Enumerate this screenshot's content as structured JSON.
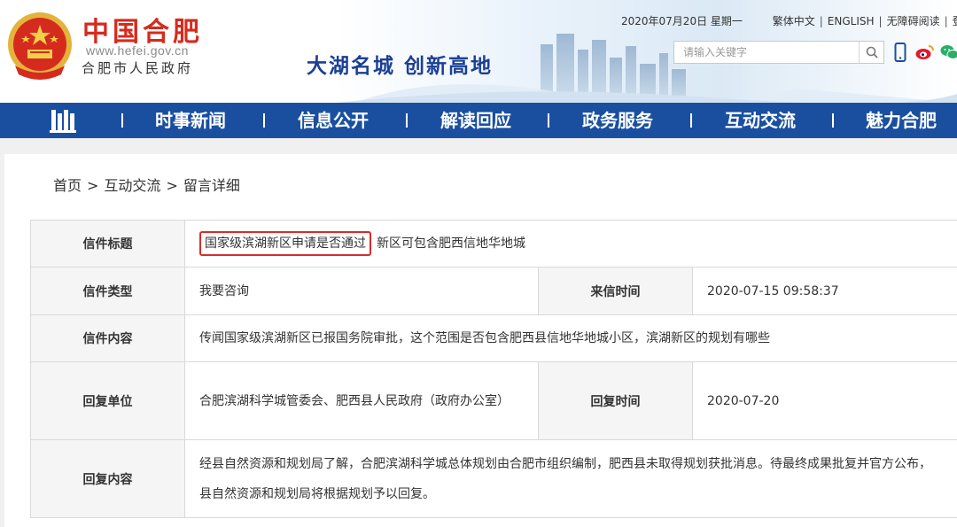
{
  "header": {
    "site_name": "中国合肥",
    "site_url": "www.hefei.gov.cn",
    "org_name": "合肥市人民政府",
    "slogan": "大湖名城  创新高地",
    "date": "2020年07月20日 星期一",
    "links": [
      "繁体中文",
      "ENGLISH",
      "无障碍阅读",
      "登"
    ],
    "search_placeholder": "请输入关键字",
    "icons": [
      "search-icon",
      "mobile-icon",
      "weibo-icon",
      "wechat-icon"
    ]
  },
  "nav": {
    "items": [
      "时事新闻",
      "信息公开",
      "解读回应",
      "政务服务",
      "互动交流",
      "魅力合肥"
    ]
  },
  "breadcrumb": {
    "items": [
      "首页",
      "互动交流",
      "留言详细"
    ],
    "separator": ">"
  },
  "message": {
    "title_label": "信件标题",
    "title_highlight": "国家级滨湖新区申请是否通过",
    "title_rest": "新区可包含肥西信地华地城",
    "type_label": "信件类型",
    "type_value": "我要咨询",
    "time_label": "来信时间",
    "time_value": "2020-07-15 09:58:37",
    "content_label": "信件内容",
    "content_value": "传闻国家级滨湖新区已报国务院审批，这个范围是否包含肥西县信地华地城小区，滨湖新区的规划有哪些",
    "reply_unit_label": "回复单位",
    "reply_unit_value": "合肥滨湖科学城管委会、肥西县人民政府（政府办公室）",
    "reply_time_label": "回复时间",
    "reply_time_value": "2020-07-20",
    "reply_content_label": "回复内容",
    "reply_content_value": "经县自然资源和规划局了解，合肥滨湖科学城总体规划由合肥市组织编制，肥西县未取得规划获批消息。待最终成果批复并官方公布，县自然资源和规划局将根据规划予以回复。"
  },
  "colors": {
    "nav_bg": "#1a4fa0",
    "brand_red": "#d52b1e",
    "label_blue": "#1f4d9b",
    "highlight_red": "#d82c2c"
  }
}
